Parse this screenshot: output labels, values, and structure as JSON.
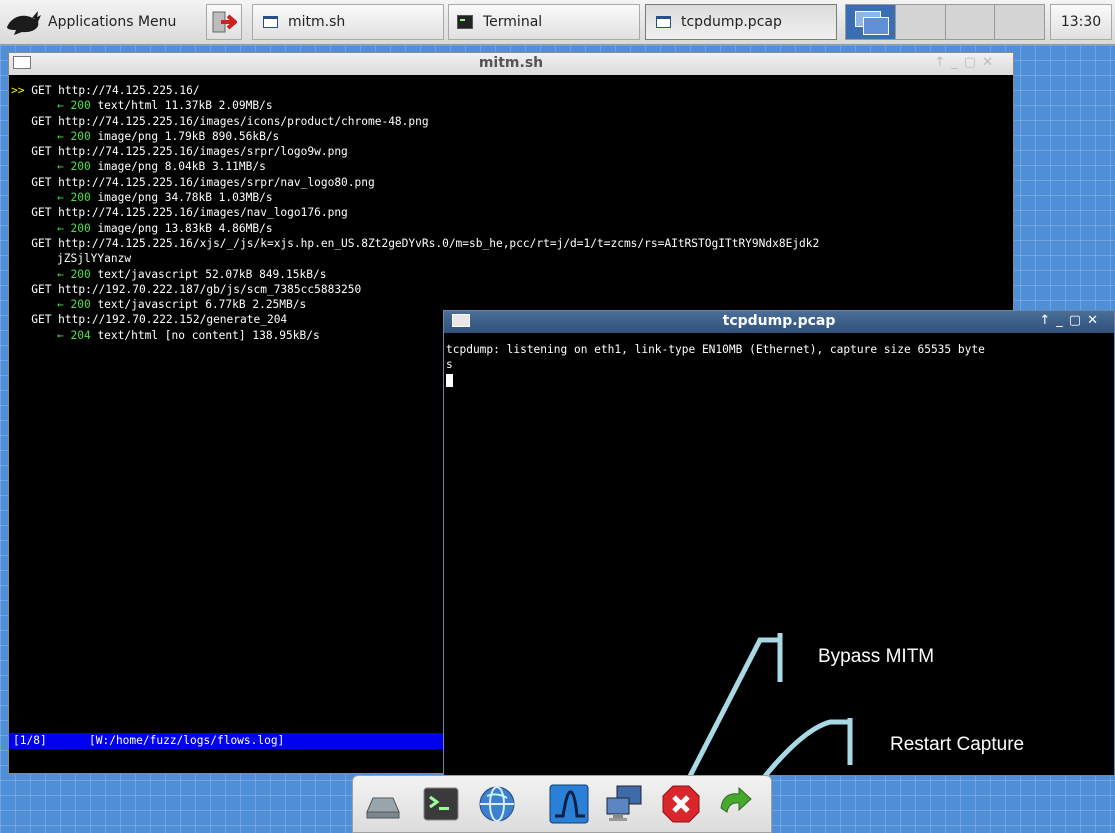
{
  "panel": {
    "apps_menu_label": "Applications Menu",
    "tasks": [
      {
        "label": "mitm.sh"
      },
      {
        "label": "Terminal"
      },
      {
        "label": "tcpdump.pcap"
      }
    ],
    "clock": "13:30"
  },
  "mitm_window": {
    "title": "mitm.sh",
    "flows": [
      {
        "method": "GET",
        "url": "http://74.125.225.16/",
        "code": "200",
        "info": "text/html 11.37kB 2.09MB/s"
      },
      {
        "method": "GET",
        "url": "http://74.125.225.16/images/icons/product/chrome-48.png",
        "code": "200",
        "info": "image/png 1.79kB 890.56kB/s"
      },
      {
        "method": "GET",
        "url": "http://74.125.225.16/images/srpr/logo9w.png",
        "code": "200",
        "info": "image/png 8.04kB 3.11MB/s"
      },
      {
        "method": "GET",
        "url": "http://74.125.225.16/images/srpr/nav_logo80.png",
        "code": "200",
        "info": "image/png 34.78kB 1.03MB/s"
      },
      {
        "method": "GET",
        "url": "http://74.125.225.16/images/nav_logo176.png",
        "code": "200",
        "info": "image/png 13.83kB 4.86MB/s"
      },
      {
        "method": "GET",
        "url": "http://74.125.225.16/xjs/_/js/k=xjs.hp.en_US.8Zt2geDYvRs.0/m=sb_he,pcc/rt=j/d=1/t=zcms/rs=AItRSTOgITtRY9Ndx8Ejdk2",
        "url_cont": "jZSjlYYanzw",
        "code": "200",
        "info": "text/javascript 52.07kB 849.15kB/s"
      },
      {
        "method": "GET",
        "url": "http://192.70.222.187/gb/js/scm_7385cc5883250",
        "code": "200",
        "info": "text/javascript 6.77kB 2.25MB/s"
      },
      {
        "method": "GET",
        "url": "http://192.70.222.152/generate_204",
        "code": "204",
        "info": "text/html [no content] 138.95kB/s"
      }
    ],
    "selected_marker": ">>",
    "response_arrow": "←",
    "status_left": "[1/8]",
    "status_right": "[W:/home/fuzz/logs/flows.log]"
  },
  "tcpdump_window": {
    "title": "tcpdump.pcap",
    "line1": "tcpdump: listening on eth1, link-type EN10MB (Ethernet), capture size 65535 byte",
    "line2": "s"
  },
  "annotations": {
    "bypass_label": "Bypass MITM",
    "restart_label": "Restart Capture"
  },
  "colors": {
    "desktop": "#4f8fd8",
    "status_bar": "#0000ee",
    "code_ok": "#4be14b",
    "marker": "#f5f500",
    "annotation_line": "#a9d9e4"
  },
  "dock_icons": [
    "drive-icon",
    "terminal-icon",
    "network-globe-icon",
    "waveform-icon",
    "computer-network-icon",
    "stop-icon",
    "refresh-icon"
  ]
}
